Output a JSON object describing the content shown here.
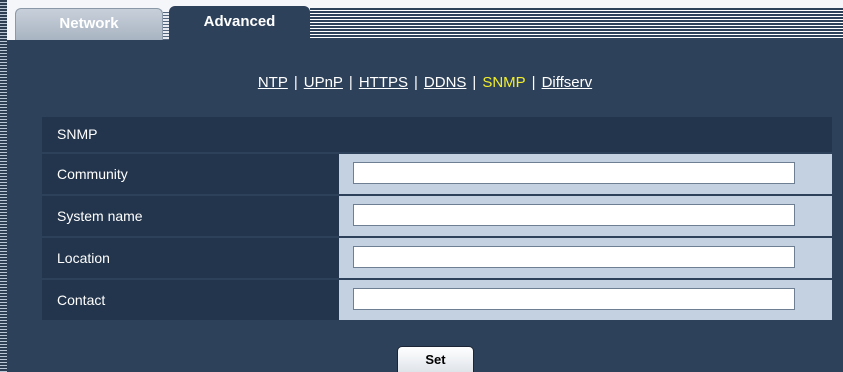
{
  "tabs": {
    "network_label": "Network",
    "advanced_label": "Advanced"
  },
  "subnav": {
    "items": [
      "NTP",
      "UPnP",
      "HTTPS",
      "DDNS",
      "SNMP",
      "Diffserv"
    ],
    "separator": "|",
    "active": "SNMP"
  },
  "section": {
    "title": "SNMP"
  },
  "fields": [
    {
      "label": "Community",
      "value": ""
    },
    {
      "label": "System name",
      "value": ""
    },
    {
      "label": "Location",
      "value": ""
    },
    {
      "label": "Contact",
      "value": ""
    }
  ],
  "actions": {
    "set_label": "Set"
  },
  "colors": {
    "panel_bg": "#2e415a",
    "label_bg": "#23354c",
    "value_bg": "#c4d1e1",
    "active_link": "#f2ef2a"
  }
}
